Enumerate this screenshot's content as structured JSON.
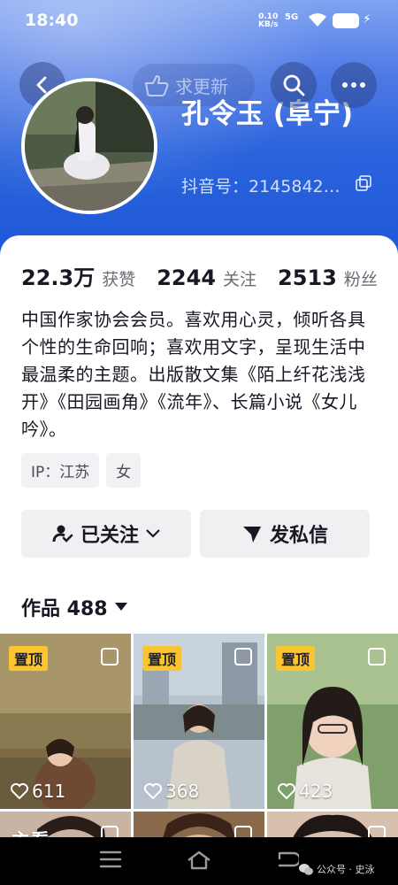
{
  "status_bar": {
    "time": "18:40",
    "net_speed": "0.10",
    "net_unit": "KB/s",
    "network": "5G"
  },
  "header": {
    "update_label": "求更新",
    "name": "孔令玉 (阜宁)",
    "douyin_id": "抖音号：2145842…"
  },
  "stats": [
    {
      "value": "22.3万",
      "label": "获赞"
    },
    {
      "value": "2244",
      "label": "关注"
    },
    {
      "value": "2513",
      "label": "粉丝"
    }
  ],
  "bio": "中国作家协会会员。喜欢用心灵，倾听各具个性的生命回响；喜欢用文字，呈现生活中最温柔的主题。出版散文集《陌上纤花浅浅开》《田园画角》《流年》、长篇小说《女儿吟》。",
  "tags": [
    "IP：江苏",
    "女"
  ],
  "actions": {
    "follow_label": "已关注",
    "message_label": "发私信"
  },
  "works": {
    "label": "作品 488"
  },
  "grid": [
    {
      "pin": "置顶",
      "likes": "611"
    },
    {
      "pin": "置顶",
      "likes": "368"
    },
    {
      "pin": "置顶",
      "likes": "423"
    },
    {
      "caption": "主看"
    },
    {},
    {}
  ],
  "watermark": "公众号 · 史泳",
  "colors": {
    "header_blue": "#2a63dc",
    "pin_yellow": "#fbc531",
    "text_dark": "#161823"
  }
}
